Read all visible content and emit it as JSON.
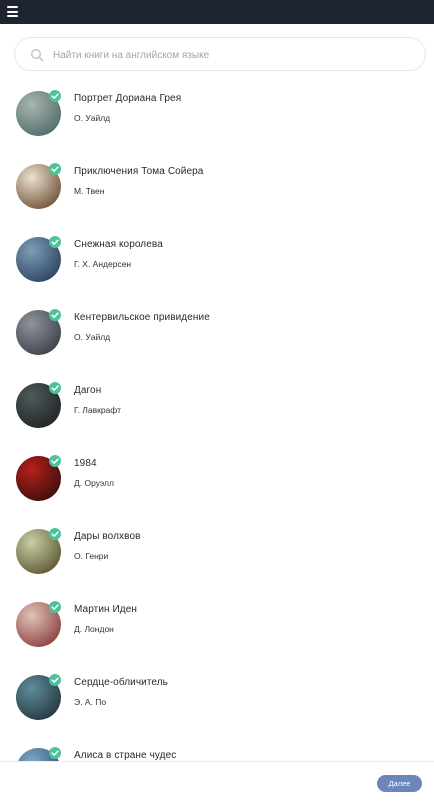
{
  "search": {
    "placeholder": "Найти книги на английском языке"
  },
  "books": [
    {
      "title": "Портрет Дориана Грея",
      "author": "О. Уайлд",
      "icon": "book-cover-portrait",
      "colors": [
        "#a9b6ad",
        "#4d6a6a"
      ]
    },
    {
      "title": "Приключения Тома Сойера",
      "author": "М. Твен",
      "icon": "book-cover-boy",
      "colors": [
        "#e9e1cf",
        "#6e4f35"
      ]
    },
    {
      "title": "Снежная королева",
      "author": "Г. Х. Андерсен",
      "icon": "book-cover-snow-queen",
      "colors": [
        "#7d9db5",
        "#2c3f5f"
      ]
    },
    {
      "title": "Кентервильское привидение",
      "author": "О. Уайлд",
      "icon": "book-cover-ghost",
      "colors": [
        "#8f939b",
        "#3a3f47"
      ]
    },
    {
      "title": "Дагон",
      "author": "Г. Лавкрафт",
      "icon": "book-cover-dagon",
      "colors": [
        "#4f5a5a",
        "#1f2324"
      ]
    },
    {
      "title": "1984",
      "author": "Д. Оруэлл",
      "icon": "book-cover-1984",
      "colors": [
        "#b5201b",
        "#3a0d0c"
      ]
    },
    {
      "title": "Дары волхвов",
      "author": "О. Генри",
      "icon": "book-cover-gift",
      "colors": [
        "#c7cfa3",
        "#5b5431"
      ]
    },
    {
      "title": "Мартин Иден",
      "author": "Д. Лондон",
      "icon": "book-cover-ship",
      "colors": [
        "#e0c3b7",
        "#8a3d3d"
      ]
    },
    {
      "title": "Сердце-обличитель",
      "author": "Э. А. По",
      "icon": "book-cover-heart",
      "colors": [
        "#5d8e9a",
        "#24343c"
      ]
    },
    {
      "title": "Алиса в стране чудес",
      "author": "",
      "icon": "book-cover-alice",
      "colors": [
        "#7fa9c9",
        "#2c4a6b"
      ]
    }
  ],
  "check_color": "#4cc39a",
  "footer": {
    "next_label": "Далее"
  },
  "accent": "#6b86b8",
  "topbar_color": "#1f2433"
}
